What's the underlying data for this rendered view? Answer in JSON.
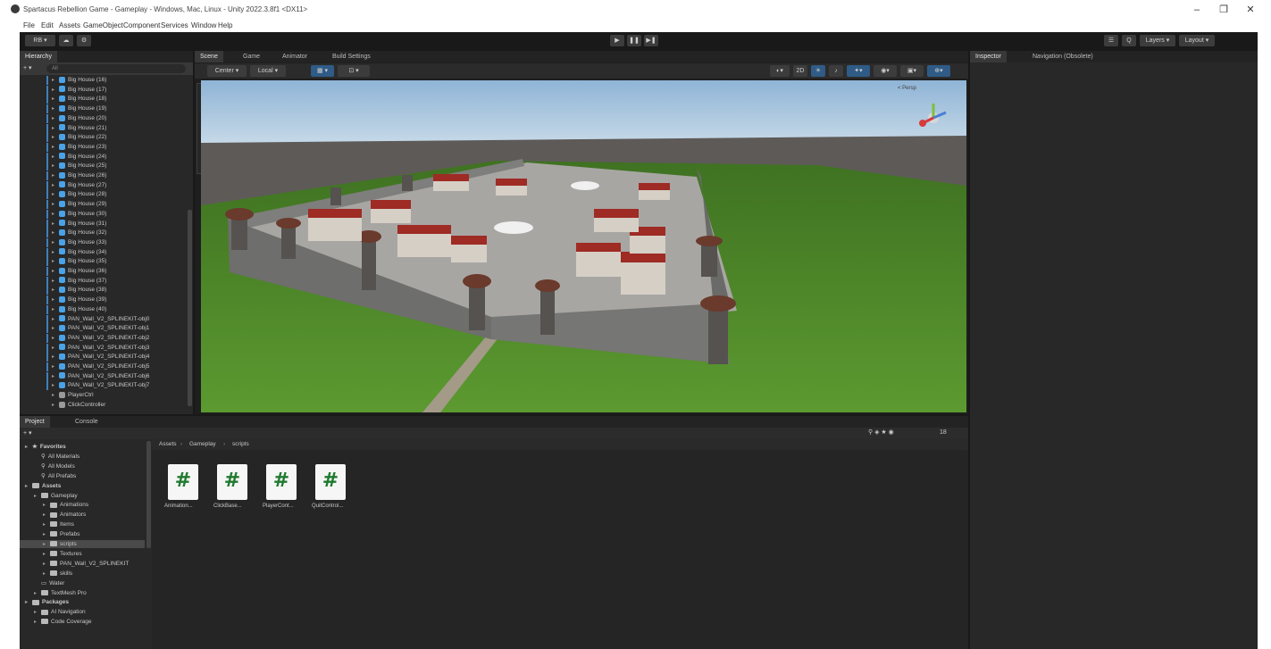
{
  "window": {
    "title": "Spartacus Rebellion Game - Gameplay - Windows, Mac, Linux - Unity 2022.3.8f1 <DX11>",
    "controls": [
      "–",
      "❐",
      "✕"
    ]
  },
  "menu": [
    "File",
    "Edit",
    "Assets",
    "GameObject",
    "Component",
    "Services",
    "Window",
    "Help"
  ],
  "toolbar": {
    "account": "RB ▾",
    "cloud_icon": "cloud-icon",
    "play_icons": [
      "▶",
      "❚❚",
      "▶❚"
    ],
    "right": [
      "☰",
      "Q",
      "Layers ▾",
      "Layout ▾"
    ]
  },
  "hierarchy": {
    "tab": "Hierarchy",
    "search_placeholder": "All",
    "items": [
      "Big House (16)",
      "Big House (17)",
      "Big House (18)",
      "Big House (19)",
      "Big House (20)",
      "Big House (21)",
      "Big House (22)",
      "Big House (23)",
      "Big House (24)",
      "Big House (25)",
      "Big House (26)",
      "Big House (27)",
      "Big House (28)",
      "Big House (29)",
      "Big House (30)",
      "Big House (31)",
      "Big House (32)",
      "Big House (33)",
      "Big House (34)",
      "Big House (35)",
      "Big House (36)",
      "Big House (37)",
      "Big House (38)",
      "Big House (39)",
      "Big House (40)",
      "PAN_Wall_V2_SPLINEKIT-obj0",
      "PAN_Wall_V2_SPLINEKIT-obj1",
      "PAN_Wall_V2_SPLINEKIT-obj2",
      "PAN_Wall_V2_SPLINEKIT-obj3",
      "PAN_Wall_V2_SPLINEKIT-obj4",
      "PAN_Wall_V2_SPLINEKIT-obj5",
      "PAN_Wall_V2_SPLINEKIT-obj6",
      "PAN_Wall_V2_SPLINEKIT-obj7",
      "PlayerCtrl",
      "ClickController"
    ]
  },
  "scene": {
    "tabs": [
      "Scene",
      "Game",
      "Animator",
      "Build Settings"
    ],
    "toolbar_left": [
      "Center ▾",
      "Local ▾"
    ],
    "persp_label": "< Persp"
  },
  "inspector": {
    "tabs": [
      "Inspector",
      "Navigation (Obsolete)"
    ]
  },
  "project": {
    "tabs": [
      "Project",
      "Console"
    ],
    "add_label": "+ ▾",
    "search_count": "18",
    "breadcrumb": [
      "Assets",
      "Gameplay",
      "scripts"
    ],
    "tree": [
      {
        "label": "Favorites",
        "level": 0,
        "kind": "star"
      },
      {
        "label": "All Materials",
        "level": 1,
        "kind": "search"
      },
      {
        "label": "All Models",
        "level": 1,
        "kind": "search"
      },
      {
        "label": "All Prefabs",
        "level": 1,
        "kind": "search"
      },
      {
        "label": "Assets",
        "level": 0,
        "kind": "folder"
      },
      {
        "label": "Gameplay",
        "level": 1,
        "kind": "folder"
      },
      {
        "label": "Animations",
        "level": 2,
        "kind": "folder"
      },
      {
        "label": "Animators",
        "level": 2,
        "kind": "folder"
      },
      {
        "label": "Items",
        "level": 2,
        "kind": "folder"
      },
      {
        "label": "Prefabs",
        "level": 2,
        "kind": "folder"
      },
      {
        "label": "scripts",
        "level": 2,
        "kind": "folder",
        "selected": true
      },
      {
        "label": "Textures",
        "level": 2,
        "kind": "folder"
      },
      {
        "label": "PAN_Wall_V2_SPLINEKIT",
        "level": 2,
        "kind": "folder"
      },
      {
        "label": "skills",
        "level": 2,
        "kind": "folder"
      },
      {
        "label": "Water",
        "level": 1,
        "kind": "file"
      },
      {
        "label": "TextMesh Pro",
        "level": 1,
        "kind": "folder"
      },
      {
        "label": "Packages",
        "level": 0,
        "kind": "folder"
      },
      {
        "label": "AI Navigation",
        "level": 1,
        "kind": "folder"
      },
      {
        "label": "Code Coverage",
        "level": 1,
        "kind": "folder"
      }
    ],
    "assets": [
      {
        "label": "Animation...",
        "icon": "#"
      },
      {
        "label": "ClickBase...",
        "icon": "#"
      },
      {
        "label": "PlayerCont...",
        "icon": "#"
      },
      {
        "label": "QuitControl...",
        "icon": "#"
      }
    ]
  },
  "colors": {
    "sky_top": "#8fb4d6",
    "sky_horizon": "#dce8ef",
    "grass": "#4f8a2a",
    "ground_grey": "#5e5a58",
    "wall": "#8a8a88",
    "roof": "#9e2b24",
    "selection": "#2c5d87",
    "script_icon_green": "#1f7a2e"
  }
}
